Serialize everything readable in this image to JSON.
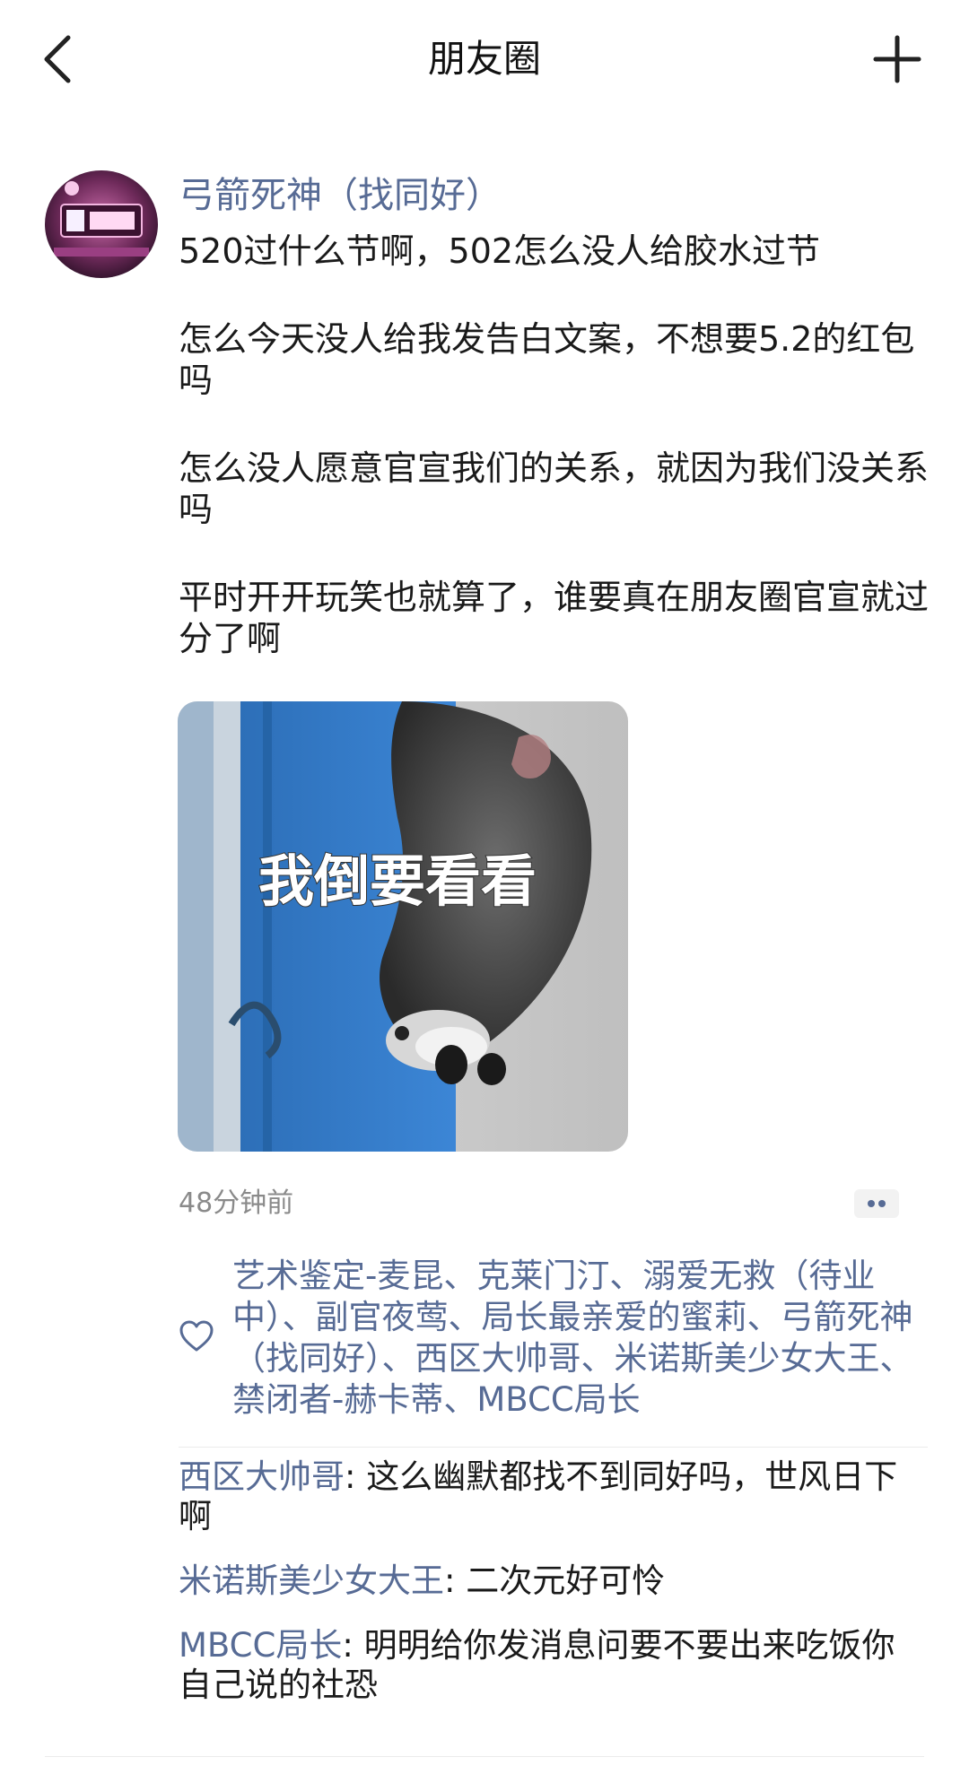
{
  "header": {
    "title": "朋友圈"
  },
  "post": {
    "author": "弓箭死神（找同好）",
    "paragraphs": [
      "520过什么节啊，502怎么没人给胶水过节",
      "怎么今天没人给我发告白文案，不想要5.2的红包吗",
      "怎么没人愿意官宣我们的关系，就因为我们没关系吗",
      "平时开开玩笑也就算了，谁要真在朋友圈官宣就过分了啊"
    ],
    "image_caption": "我倒要看看",
    "time": "48分钟前"
  },
  "likes": {
    "text": "艺术鉴定-麦昆、克莱门汀、溺爱无救（待业中）、副官夜莺、局长最亲爱的蜜莉、弓箭死神（找同好）、西区大帅哥、米诺斯美少女大王、禁闭者-赫卡蒂、MBCC局长"
  },
  "comments": [
    {
      "name": "西区大帅哥",
      "sep": ": ",
      "text": "这么幽默都找不到同好吗，世风日下啊"
    },
    {
      "name": "米诺斯美少女大王",
      "sep": ": ",
      "text": "二次元好可怜"
    },
    {
      "name": "MBCC局长",
      "sep": ": ",
      "text": "明明给你发消息问要不要出来吃饭你自己说的社恐"
    }
  ],
  "colors": {
    "name_blue": "#576b95",
    "time_gray": "#8a8a8a"
  },
  "icons": {
    "back": "chevron-left-icon",
    "add": "plus-icon",
    "more": "two-dots-icon",
    "like": "heart-outline-icon"
  }
}
